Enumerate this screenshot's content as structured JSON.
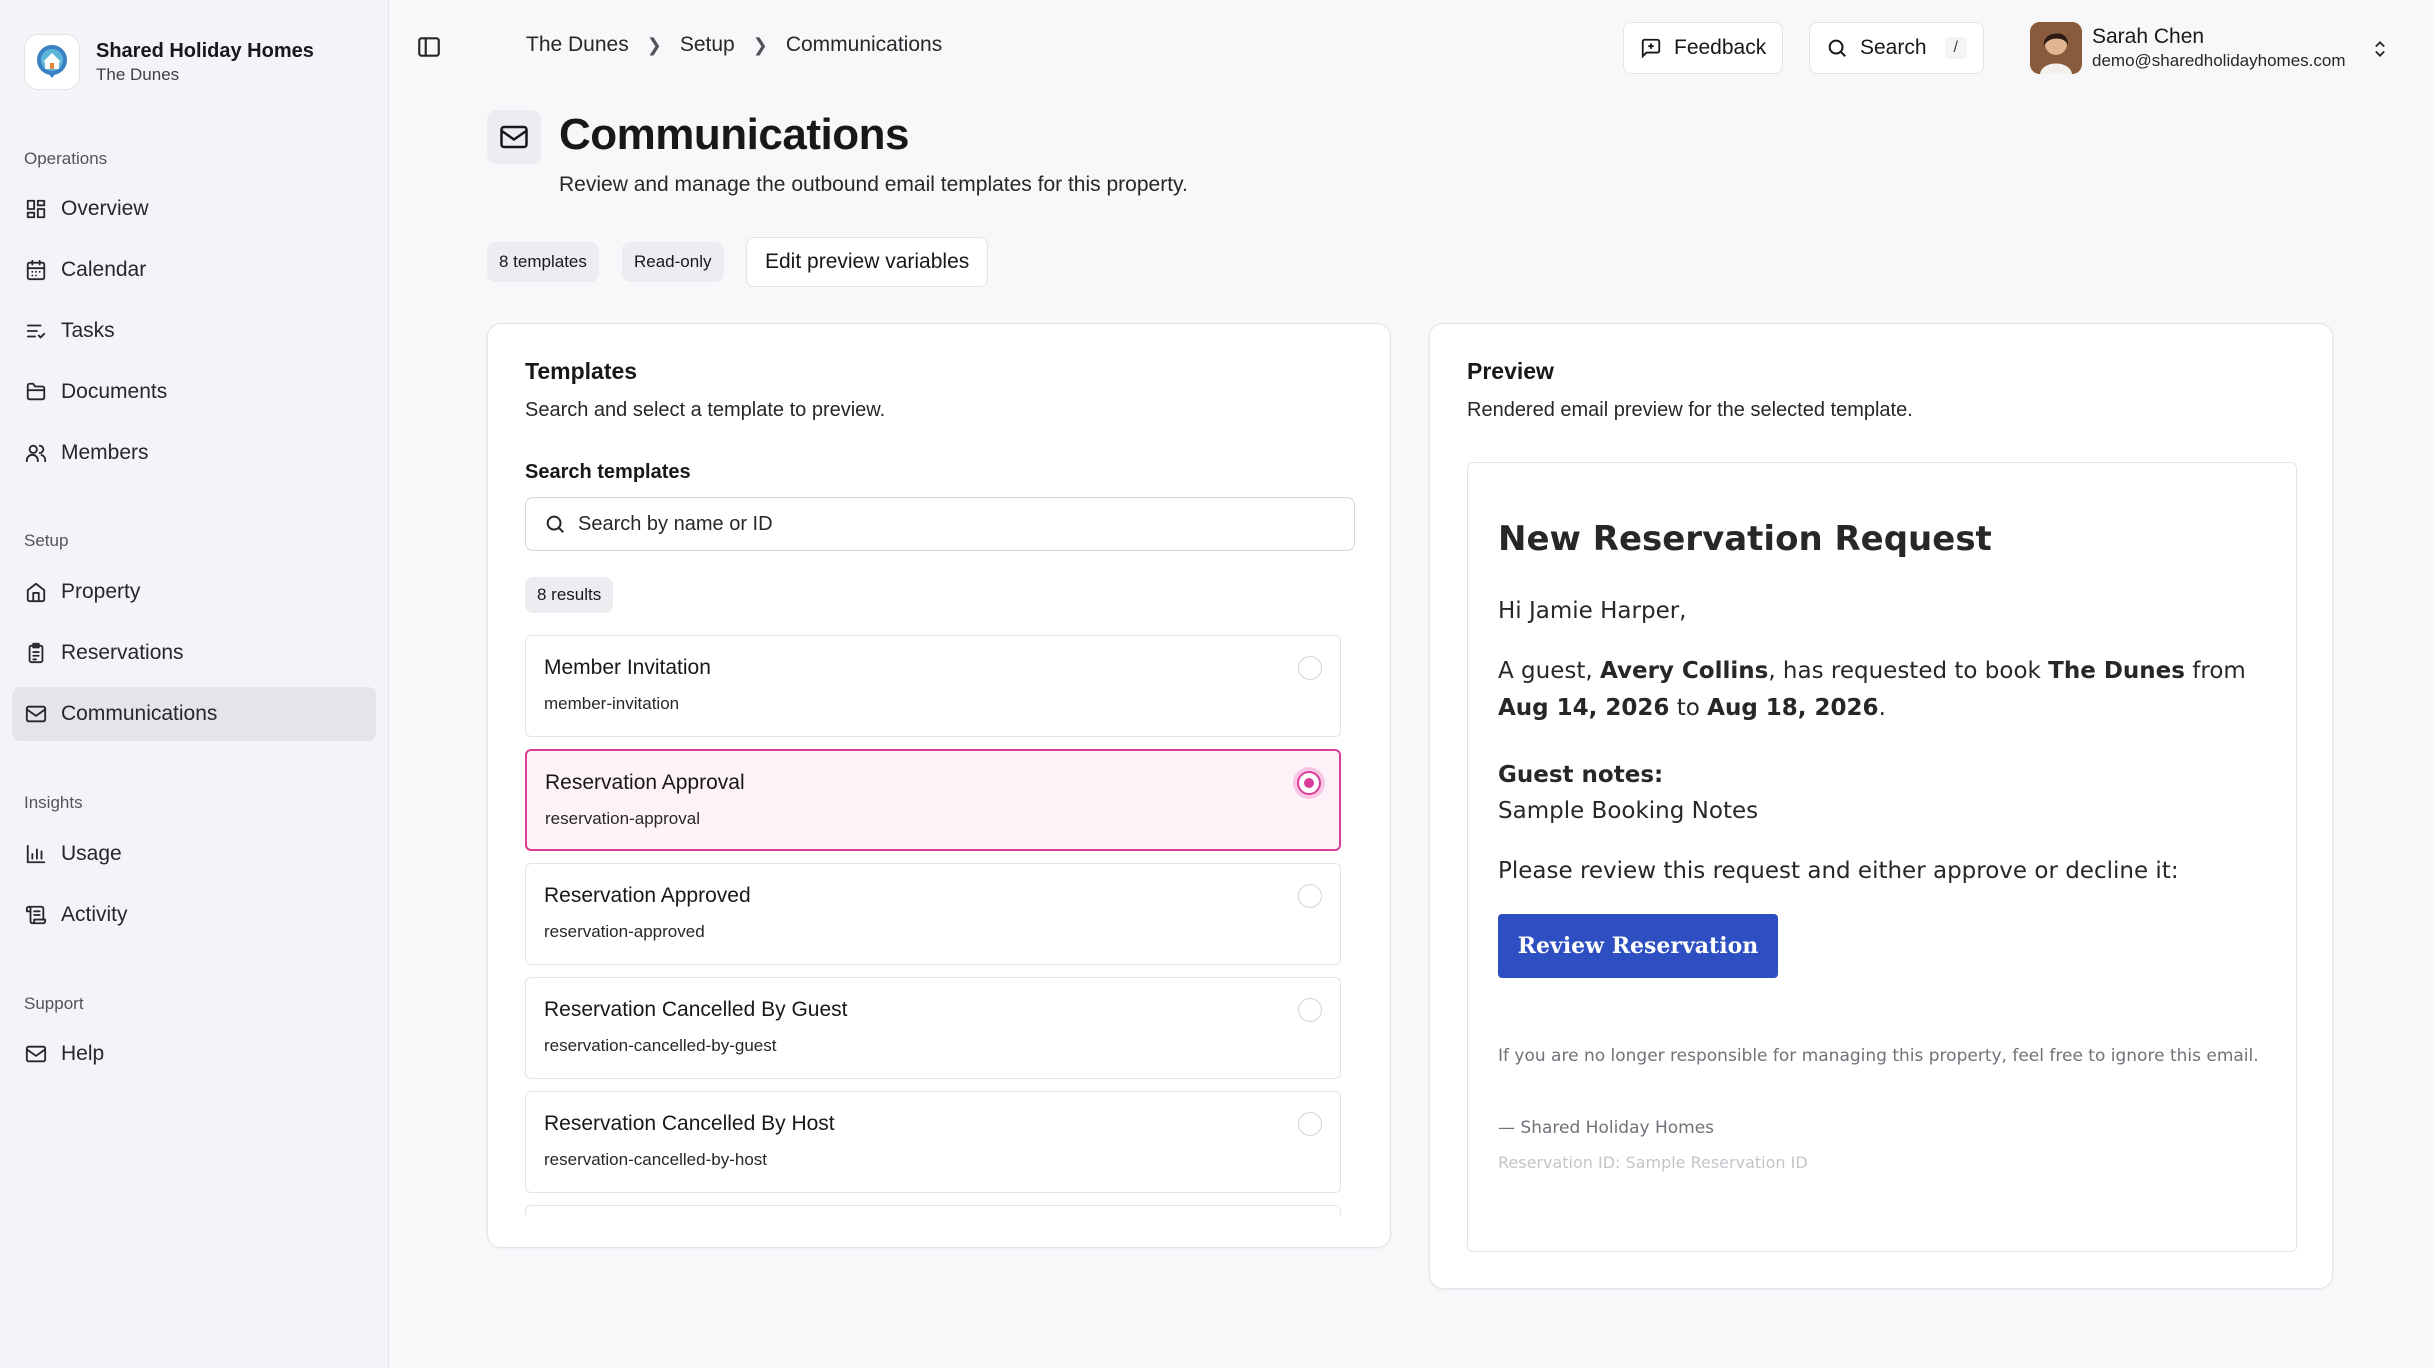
{
  "brand": {
    "name": "Shared Holiday Homes",
    "property": "The Dunes"
  },
  "nav": {
    "sections": [
      {
        "label": "Operations",
        "items": [
          {
            "label": "Overview",
            "icon": "grid-icon"
          },
          {
            "label": "Calendar",
            "icon": "calendar-icon"
          },
          {
            "label": "Tasks",
            "icon": "list-checks-icon"
          },
          {
            "label": "Documents",
            "icon": "folder-icon"
          },
          {
            "label": "Members",
            "icon": "users-icon"
          }
        ]
      },
      {
        "label": "Setup",
        "items": [
          {
            "label": "Property",
            "icon": "home-icon"
          },
          {
            "label": "Reservations",
            "icon": "clipboard-icon"
          },
          {
            "label": "Communications",
            "icon": "mail-icon",
            "active": true
          }
        ]
      },
      {
        "label": "Insights",
        "items": [
          {
            "label": "Usage",
            "icon": "bar-chart-icon"
          },
          {
            "label": "Activity",
            "icon": "scroll-icon"
          }
        ]
      },
      {
        "label": "Support",
        "items": [
          {
            "label": "Help",
            "icon": "mail-icon"
          }
        ]
      }
    ]
  },
  "breadcrumb": [
    "The Dunes",
    "Setup",
    "Communications"
  ],
  "topbar": {
    "feedback": "Feedback",
    "search": "Search",
    "search_shortcut": "/"
  },
  "user": {
    "name": "Sarah Chen",
    "email": "demo@sharedholidayhomes.com"
  },
  "page": {
    "title": "Communications",
    "subtitle": "Review and manage the outbound email templates for this property.",
    "chips": [
      "8 templates",
      "Read-only"
    ],
    "edit_button": "Edit preview variables"
  },
  "templates_card": {
    "title": "Templates",
    "subtitle": "Search and select a template to preview.",
    "search_label": "Search templates",
    "search_placeholder": "Search by name or ID",
    "results": "8 results",
    "items": [
      {
        "name": "Member Invitation",
        "id": "member-invitation",
        "selected": false
      },
      {
        "name": "Reservation Approval",
        "id": "reservation-approval",
        "selected": true
      },
      {
        "name": "Reservation Approved",
        "id": "reservation-approved",
        "selected": false
      },
      {
        "name": "Reservation Cancelled By Guest",
        "id": "reservation-cancelled-by-guest",
        "selected": false
      },
      {
        "name": "Reservation Cancelled By Host",
        "id": "reservation-cancelled-by-host",
        "selected": false
      }
    ]
  },
  "preview_card": {
    "title": "Preview",
    "subtitle": "Rendered email preview for the selected template.",
    "email": {
      "heading": "New Reservation Request",
      "greeting": "Hi Jamie Harper,",
      "body_prefix": "A guest, ",
      "guest": "Avery Collins",
      "body_mid1": ", has requested to book ",
      "property": "The Dunes",
      "body_mid2": " from ",
      "start_date": "Aug 14, 2026",
      "body_mid3": " to ",
      "end_date": "Aug 18, 2026",
      "body_suffix": ".",
      "notes_label": "Guest notes:",
      "notes": "Sample Booking Notes",
      "cta_intro": "Please review this request and either approve or decline it:",
      "cta_button": "Review Reservation",
      "disclaimer": "If you are no longer responsible for managing this property, feel free to ignore this email.",
      "signature": "— Shared Holiday Homes",
      "reservation_id": "Reservation ID: Sample Reservation ID"
    }
  },
  "colors": {
    "accent_pink": "#db3d9c",
    "cta_blue": "#2e4fc1",
    "sidebar_bg": "#f4f4f8"
  }
}
